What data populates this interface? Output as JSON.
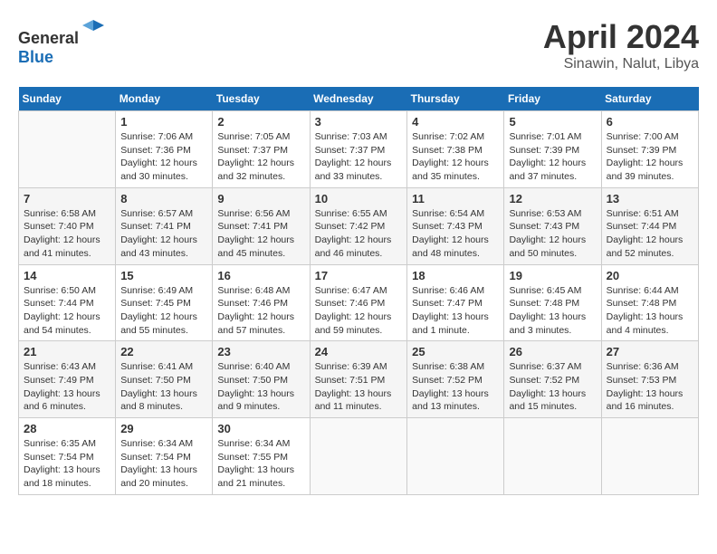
{
  "header": {
    "logo_general": "General",
    "logo_blue": "Blue",
    "month": "April 2024",
    "location": "Sinawin, Nalut, Libya"
  },
  "weekdays": [
    "Sunday",
    "Monday",
    "Tuesday",
    "Wednesday",
    "Thursday",
    "Friday",
    "Saturday"
  ],
  "weeks": [
    [
      {
        "day": "",
        "info": ""
      },
      {
        "day": "1",
        "info": "Sunrise: 7:06 AM\nSunset: 7:36 PM\nDaylight: 12 hours\nand 30 minutes."
      },
      {
        "day": "2",
        "info": "Sunrise: 7:05 AM\nSunset: 7:37 PM\nDaylight: 12 hours\nand 32 minutes."
      },
      {
        "day": "3",
        "info": "Sunrise: 7:03 AM\nSunset: 7:37 PM\nDaylight: 12 hours\nand 33 minutes."
      },
      {
        "day": "4",
        "info": "Sunrise: 7:02 AM\nSunset: 7:38 PM\nDaylight: 12 hours\nand 35 minutes."
      },
      {
        "day": "5",
        "info": "Sunrise: 7:01 AM\nSunset: 7:39 PM\nDaylight: 12 hours\nand 37 minutes."
      },
      {
        "day": "6",
        "info": "Sunrise: 7:00 AM\nSunset: 7:39 PM\nDaylight: 12 hours\nand 39 minutes."
      }
    ],
    [
      {
        "day": "7",
        "info": "Sunrise: 6:58 AM\nSunset: 7:40 PM\nDaylight: 12 hours\nand 41 minutes."
      },
      {
        "day": "8",
        "info": "Sunrise: 6:57 AM\nSunset: 7:41 PM\nDaylight: 12 hours\nand 43 minutes."
      },
      {
        "day": "9",
        "info": "Sunrise: 6:56 AM\nSunset: 7:41 PM\nDaylight: 12 hours\nand 45 minutes."
      },
      {
        "day": "10",
        "info": "Sunrise: 6:55 AM\nSunset: 7:42 PM\nDaylight: 12 hours\nand 46 minutes."
      },
      {
        "day": "11",
        "info": "Sunrise: 6:54 AM\nSunset: 7:43 PM\nDaylight: 12 hours\nand 48 minutes."
      },
      {
        "day": "12",
        "info": "Sunrise: 6:53 AM\nSunset: 7:43 PM\nDaylight: 12 hours\nand 50 minutes."
      },
      {
        "day": "13",
        "info": "Sunrise: 6:51 AM\nSunset: 7:44 PM\nDaylight: 12 hours\nand 52 minutes."
      }
    ],
    [
      {
        "day": "14",
        "info": "Sunrise: 6:50 AM\nSunset: 7:44 PM\nDaylight: 12 hours\nand 54 minutes."
      },
      {
        "day": "15",
        "info": "Sunrise: 6:49 AM\nSunset: 7:45 PM\nDaylight: 12 hours\nand 55 minutes."
      },
      {
        "day": "16",
        "info": "Sunrise: 6:48 AM\nSunset: 7:46 PM\nDaylight: 12 hours\nand 57 minutes."
      },
      {
        "day": "17",
        "info": "Sunrise: 6:47 AM\nSunset: 7:46 PM\nDaylight: 12 hours\nand 59 minutes."
      },
      {
        "day": "18",
        "info": "Sunrise: 6:46 AM\nSunset: 7:47 PM\nDaylight: 13 hours\nand 1 minute."
      },
      {
        "day": "19",
        "info": "Sunrise: 6:45 AM\nSunset: 7:48 PM\nDaylight: 13 hours\nand 3 minutes."
      },
      {
        "day": "20",
        "info": "Sunrise: 6:44 AM\nSunset: 7:48 PM\nDaylight: 13 hours\nand 4 minutes."
      }
    ],
    [
      {
        "day": "21",
        "info": "Sunrise: 6:43 AM\nSunset: 7:49 PM\nDaylight: 13 hours\nand 6 minutes."
      },
      {
        "day": "22",
        "info": "Sunrise: 6:41 AM\nSunset: 7:50 PM\nDaylight: 13 hours\nand 8 minutes."
      },
      {
        "day": "23",
        "info": "Sunrise: 6:40 AM\nSunset: 7:50 PM\nDaylight: 13 hours\nand 9 minutes."
      },
      {
        "day": "24",
        "info": "Sunrise: 6:39 AM\nSunset: 7:51 PM\nDaylight: 13 hours\nand 11 minutes."
      },
      {
        "day": "25",
        "info": "Sunrise: 6:38 AM\nSunset: 7:52 PM\nDaylight: 13 hours\nand 13 minutes."
      },
      {
        "day": "26",
        "info": "Sunrise: 6:37 AM\nSunset: 7:52 PM\nDaylight: 13 hours\nand 15 minutes."
      },
      {
        "day": "27",
        "info": "Sunrise: 6:36 AM\nSunset: 7:53 PM\nDaylight: 13 hours\nand 16 minutes."
      }
    ],
    [
      {
        "day": "28",
        "info": "Sunrise: 6:35 AM\nSunset: 7:54 PM\nDaylight: 13 hours\nand 18 minutes."
      },
      {
        "day": "29",
        "info": "Sunrise: 6:34 AM\nSunset: 7:54 PM\nDaylight: 13 hours\nand 20 minutes."
      },
      {
        "day": "30",
        "info": "Sunrise: 6:34 AM\nSunset: 7:55 PM\nDaylight: 13 hours\nand 21 minutes."
      },
      {
        "day": "",
        "info": ""
      },
      {
        "day": "",
        "info": ""
      },
      {
        "day": "",
        "info": ""
      },
      {
        "day": "",
        "info": ""
      }
    ]
  ]
}
